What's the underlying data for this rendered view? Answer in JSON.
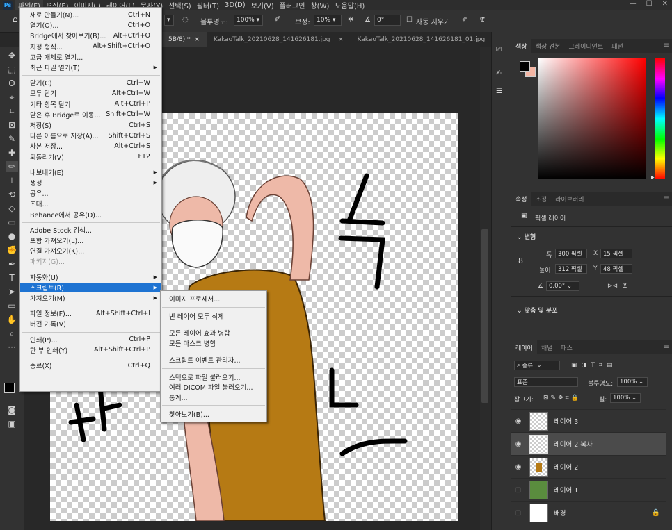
{
  "menubar": {
    "app_icon": "Ps",
    "items": [
      "파일(F)",
      "편집(E)",
      "이미지(I)",
      "레이어(L)",
      "문자(Y)",
      "선택(S)",
      "필터(T)",
      "3D(D)",
      "보기(V)",
      "플러그인",
      "창(W)",
      "도움말(H)"
    ]
  },
  "window_controls": {
    "minimize": "—",
    "maximize": "☐",
    "close": "✕"
  },
  "options_bar": {
    "opacity_label": "불투명도:",
    "opacity_value": "100%",
    "smoothing_label": "보정:",
    "smoothing_value": "10%",
    "angle_value": "0°",
    "auto_erase_label": "자동 지우기"
  },
  "tabs": [
    {
      "label": "5B/8) *",
      "close": "×",
      "active": true
    },
    {
      "label": "KakaoTalk_20210628_141626181.jpg",
      "close": "×",
      "active": false
    },
    {
      "label": "KakaoTalk_20210628_141626181_01.jpg",
      "close": "×",
      "active": false
    }
  ],
  "file_menu": {
    "items": [
      {
        "label": "새로 만들기(N)...",
        "shortcut": "Ctrl+N"
      },
      {
        "label": "열기(O)...",
        "shortcut": "Ctrl+O"
      },
      {
        "label": "Bridge에서 찾아보기(B)...",
        "shortcut": "Alt+Ctrl+O"
      },
      {
        "label": "지정 형식...",
        "shortcut": "Alt+Shift+Ctrl+O"
      },
      {
        "label": "고급 개체로 열기...",
        "shortcut": ""
      },
      {
        "label": "최근 파일 열기(T)",
        "shortcut": "",
        "submenu": true
      },
      {
        "label": "닫기(C)",
        "shortcut": "Ctrl+W",
        "sep_before": true
      },
      {
        "label": "모두 닫기",
        "shortcut": "Alt+Ctrl+W"
      },
      {
        "label": "기타 항목 닫기",
        "shortcut": "Alt+Ctrl+P"
      },
      {
        "label": "닫은 후 Bridge로 이동...",
        "shortcut": "Shift+Ctrl+W"
      },
      {
        "label": "저장(S)",
        "shortcut": "Ctrl+S"
      },
      {
        "label": "다른 이름으로 저장(A)...",
        "shortcut": "Shift+Ctrl+S"
      },
      {
        "label": "사본 저장...",
        "shortcut": "Alt+Ctrl+S"
      },
      {
        "label": "되돌리기(V)",
        "shortcut": "F12"
      },
      {
        "label": "내보내기(E)",
        "shortcut": "",
        "submenu": true,
        "sep_before": true
      },
      {
        "label": "생성",
        "shortcut": "",
        "submenu": true
      },
      {
        "label": "공유...",
        "shortcut": ""
      },
      {
        "label": "초대...",
        "shortcut": ""
      },
      {
        "label": "Behance에서 공유(D)...",
        "shortcut": ""
      },
      {
        "label": "Adobe Stock 검색...",
        "shortcut": "",
        "sep_before": true
      },
      {
        "label": "포함 가져오기(L)...",
        "shortcut": ""
      },
      {
        "label": "연결 가져오기(K)...",
        "shortcut": ""
      },
      {
        "label": "패키지(G)...",
        "shortcut": "",
        "disabled": true
      },
      {
        "label": "자동화(U)",
        "shortcut": "",
        "submenu": true,
        "sep_before": true
      },
      {
        "label": "스크립트(R)",
        "shortcut": "",
        "submenu": true,
        "highlighted": true
      },
      {
        "label": "가져오기(M)",
        "shortcut": "",
        "submenu": true
      },
      {
        "label": "파일 정보(F)...",
        "shortcut": "Alt+Shift+Ctrl+I",
        "sep_before": true
      },
      {
        "label": "버전 기록(V)",
        "shortcut": ""
      },
      {
        "label": "인쇄(P)...",
        "shortcut": "Ctrl+P",
        "sep_before": true
      },
      {
        "label": "한 부 인쇄(Y)",
        "shortcut": "Alt+Shift+Ctrl+P"
      },
      {
        "label": "종료(X)",
        "shortcut": "Ctrl+Q",
        "sep_before": true
      }
    ]
  },
  "scripts_submenu": {
    "items": [
      {
        "label": "이미지 프로세서..."
      },
      {
        "label": "빈 레이어 모두 삭제",
        "sep_before": true
      },
      {
        "label": "모든 레이어 효과 병합",
        "sep_before": true
      },
      {
        "label": "모든 마스크 병합"
      },
      {
        "label": "스크립트 이벤트 관리자...",
        "sep_before": true
      },
      {
        "label": "스택으로 파일 불러오기...",
        "sep_before": true
      },
      {
        "label": "여러 DICOM 파일 불러오기..."
      },
      {
        "label": "통계..."
      },
      {
        "label": "찾아보기(B)...",
        "sep_before": true
      }
    ]
  },
  "color_panel": {
    "tabs": [
      "색상",
      "색상 견본",
      "그레이디언트",
      "패턴"
    ],
    "fg_color": "#000000",
    "bg_color": "#f4b5a3"
  },
  "properties_panel": {
    "tabs": [
      "속성",
      "조정",
      "라이브러리"
    ],
    "layer_type": "픽셀 레이어",
    "section_transform": "변형",
    "width_label": "폭",
    "width_value": "300 픽셀",
    "x_label": "X",
    "x_value": "15 픽셀",
    "height_label": "높이",
    "height_value": "312 픽셀",
    "y_label": "Y",
    "y_value": "48 픽셀",
    "angle_value": "0.00°",
    "section_align": "맞춤 및 분포"
  },
  "layers_panel": {
    "tabs": [
      "레이어",
      "채널",
      "패스"
    ],
    "filter_label": "종류",
    "blend_mode": "표준",
    "opacity_label": "불투명도:",
    "opacity_value": "100%",
    "lock_label": "잠그기:",
    "fill_label": "칠:",
    "fill_value": "100%",
    "layers": [
      {
        "name": "레이어 3",
        "visible": true,
        "selected": false
      },
      {
        "name": "레이어 2 복사",
        "visible": true,
        "selected": true
      },
      {
        "name": "레이어 2",
        "visible": true,
        "selected": false
      },
      {
        "name": "레이어 1",
        "visible": false,
        "selected": false
      },
      {
        "name": "배경",
        "visible": false,
        "selected": false,
        "locked": true
      }
    ]
  }
}
